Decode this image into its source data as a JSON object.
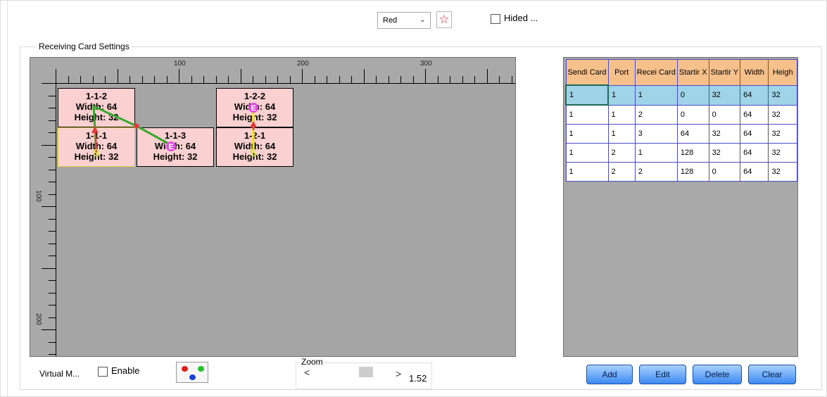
{
  "toolbar": {
    "color_select_value": "Red",
    "star_icon": "star-outline-icon",
    "hide_checkbox_label": "Hided ...",
    "hide_checked": false
  },
  "group": {
    "title": "Receiving Card Settings"
  },
  "canvas": {
    "ruler_top_labels": [
      "100",
      "200",
      "300"
    ],
    "ruler_left_labels": [
      "100",
      "200"
    ],
    "cards": [
      {
        "id": "1-1-2",
        "width_label": "Width: 64",
        "height_label": "Height: 32"
      },
      {
        "id": "1-2-2",
        "width_label": "Width: 64",
        "height_label": "Height: 32"
      },
      {
        "id": "1-1-1",
        "width_label": "Width: 64",
        "height_label": "Height: 32"
      },
      {
        "id": "1-1-3",
        "width_label": "Width: 64",
        "height_label": "Height: 32"
      },
      {
        "id": "1-2-1",
        "width_label": "Width: 64",
        "height_label": "Height: 32"
      }
    ],
    "start_marker": "S",
    "end_marker": "E"
  },
  "table": {
    "headers": [
      "Sendi Card",
      "Port",
      "Recei Card",
      "Startir X",
      "Startir Y",
      "Width",
      "Heigh"
    ],
    "rows": [
      [
        "1",
        "1",
        "1",
        "0",
        "32",
        "64",
        "32"
      ],
      [
        "1",
        "1",
        "2",
        "0",
        "0",
        "64",
        "32"
      ],
      [
        "1",
        "1",
        "3",
        "64",
        "32",
        "64",
        "32"
      ],
      [
        "1",
        "2",
        "1",
        "128",
        "32",
        "64",
        "32"
      ],
      [
        "1",
        "2",
        "2",
        "128",
        "0",
        "64",
        "32"
      ]
    ],
    "selected_row": 0
  },
  "bottom": {
    "virtual_mode_label": "Virtual M...",
    "enable_label": "Enable",
    "enable_checked": false,
    "zoom_title": "Zoom",
    "zoom_left_arrow": "<",
    "zoom_right_arrow": ">",
    "zoom_value": "1.52"
  },
  "buttons": {
    "add": "Add",
    "edit": "Edit",
    "delete": "Delete",
    "clear": "Clear"
  },
  "colors": {
    "card_fill": "#fbd0d0",
    "canvas_bg": "#a9a9a9",
    "header_fill": "#f5c089",
    "selected_row": "#9fd3e8",
    "button_blue": "#3e8af0"
  }
}
